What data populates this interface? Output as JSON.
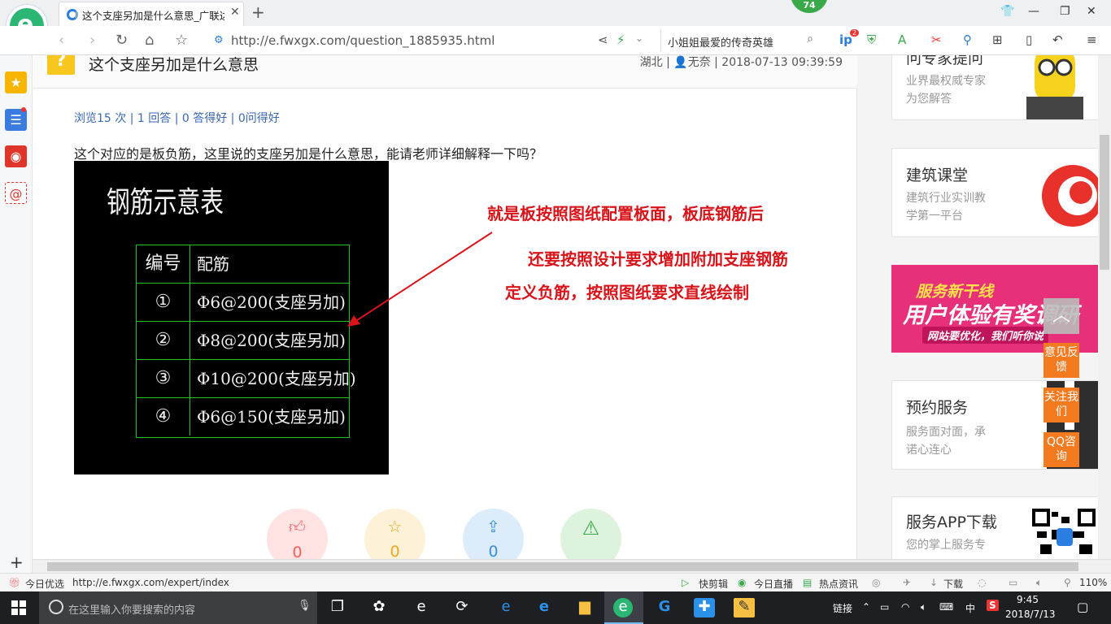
{
  "browser": {
    "tab_title": "这个支座另加是什么意思_广联达",
    "url": "http://e.fwxgx.com/question_1885935.html",
    "search_text": "小姐姐最爱的传奇英雄",
    "badge_count": "74",
    "ext_badge": "2"
  },
  "question": {
    "title": "这个支座另加是什么意思",
    "meta": "湖北 | 👤无奈 | 2018-07-13 09:39:59",
    "stats": "浏览15 次 | 1 回答 | 0 答得好 | 0问得好",
    "text": "这个对应的是板负筋，这里说的支座另加是什么意思，能请老师详细解释一下吗？"
  },
  "cad": {
    "title": "钢筋示意表",
    "header": {
      "no": "编号",
      "rebar": "配筋"
    },
    "rows": [
      {
        "no": "①",
        "rebar": "Φ6@200(支座另加)"
      },
      {
        "no": "②",
        "rebar": "Φ8@200(支座另加)"
      },
      {
        "no": "③",
        "rebar": "Φ10@200(支座另加)"
      },
      {
        "no": "④",
        "rebar": "Φ6@150(支座另加)"
      }
    ],
    "annotation": [
      "就是板按照图纸配置板面，板底钢筋后",
      "还要按照设计要求增加附加支座钢筋",
      "定义负筋，按照图纸要求直线绘制"
    ],
    "arrow_color": "#d8141a"
  },
  "actions": [
    {
      "icon": "thumb-up-icon",
      "count": "0",
      "color": "#ff5d5d"
    },
    {
      "icon": "star-icon",
      "count": "0",
      "color": "#f5a623"
    },
    {
      "icon": "share-icon",
      "count": "0",
      "color": "#3b8fe0"
    },
    {
      "icon": "warning-icon",
      "count": "",
      "color": "#3aa94a"
    }
  ],
  "sidebar": {
    "expert": {
      "title": "问专家提问",
      "desc": [
        "业界最权威专家",
        "为您解答"
      ]
    },
    "course": {
      "title": "建筑课堂",
      "desc": [
        "建筑行业实训教",
        "学第一平台"
      ]
    },
    "banner": {
      "line1": "服务新干线",
      "line2": "用户体验有奖调研",
      "line3": "网站要优化，我们听你说"
    },
    "booking": {
      "title": "预约服务",
      "desc": [
        "服务面对面，承",
        "诺心连心"
      ]
    },
    "app": {
      "title": "服务APP下载",
      "desc": [
        "您的掌上服务专"
      ]
    },
    "float_buttons": [
      "意见反馈",
      "关注我们",
      "QQ咨询"
    ]
  },
  "statusbar": {
    "left_label": "今日优选",
    "link": "http://e.fwxgx.com/expert/index",
    "items": [
      "快剪辑",
      "今日直播",
      "热点资讯",
      "下载",
      "110%"
    ]
  },
  "taskbar": {
    "search_placeholder": "在这里输入你要搜索的内容",
    "tray_label": "链接",
    "ime": "中",
    "time": "9:45",
    "date": "2018/7/13"
  }
}
